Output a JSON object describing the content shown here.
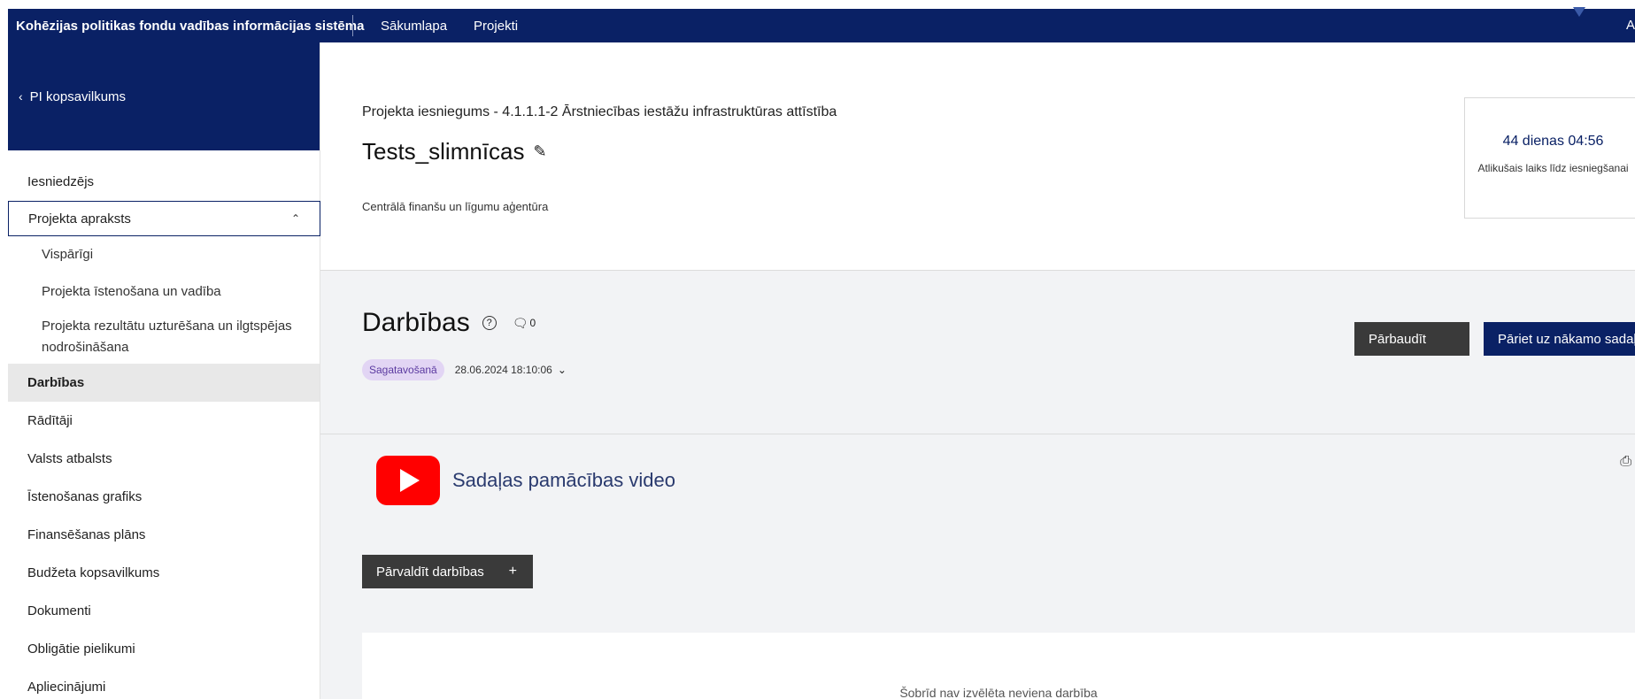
{
  "topbar": {
    "app_title": "Kohēzijas politikas fondu vadības informācijas sistēma",
    "nav": [
      "Sākumlapa",
      "Projekti"
    ],
    "user_initial": "A"
  },
  "sidebar": {
    "back_label": "PI kopsavilkums",
    "items": [
      {
        "label": "Iesniedzējs"
      },
      {
        "label": "Projekta apraksts",
        "expanded": true,
        "sub": [
          "Vispārīgi",
          "Projekta īstenošana un vadība",
          "Projekta rezultātu uzturēšana un ilgtspējas nodrošināšana"
        ]
      },
      {
        "label": "Darbības",
        "active": true
      },
      {
        "label": "Rādītāji"
      },
      {
        "label": "Valsts atbalsts"
      },
      {
        "label": "Īstenošanas grafiks"
      },
      {
        "label": "Finansēšanas plāns"
      },
      {
        "label": "Budžeta kopsavilkums"
      },
      {
        "label": "Dokumenti"
      },
      {
        "label": "Obligātie pielikumi"
      },
      {
        "label": "Apliecinājumi"
      }
    ]
  },
  "project": {
    "subtitle": "Projekta iesniegums - 4.1.1.1-2 Ārstniecības iestāžu infrastruktūras attīstība",
    "title": "Tests_slimnīcas",
    "organization": "Centrālā finanšu un līgumu aģentūra",
    "timer_value": "44 dienas 04:56",
    "timer_label": "Atlikušais laiks līdz iesniegšanai"
  },
  "section": {
    "title": "Darbības",
    "comment_count": "0",
    "status": "Sagatavošanā",
    "date": "28.06.2024 18:10:06",
    "check_button": "Pārbaudīt",
    "next_button": "Pāriet uz nākamo sadaļu"
  },
  "content": {
    "video_label": "Sadaļas pamācības video",
    "manage_button": "Pārvaldīt darbības",
    "empty_text": "Šobrīd nav izvēlēta neviena darbība"
  },
  "colors": {
    "brand_navy": "#0a2165",
    "dark_button": "#3a3a3a",
    "status_badge_bg": "#e2d5f4",
    "youtube_red": "#ff0000"
  }
}
